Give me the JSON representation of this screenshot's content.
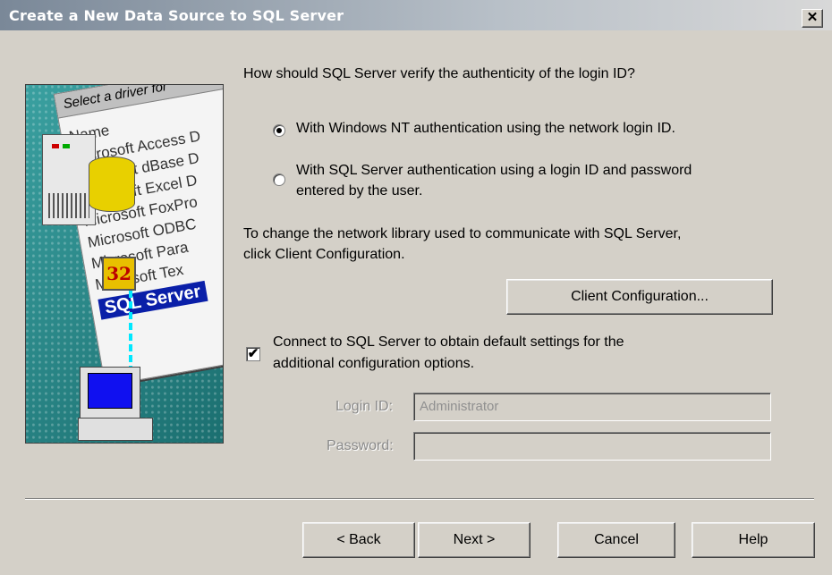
{
  "window": {
    "title": "Create a New Data Source to SQL Server",
    "close_glyph": "✕"
  },
  "illustration": {
    "header": "Select a driver for",
    "items": [
      "Name",
      "Microsoft Access D",
      "Microsoft dBase D",
      "Microsoft Excel D",
      "Microsoft FoxPro",
      "Microsoft ODBC",
      "Microsoft Para",
      "Microsoft Tex",
      "SQL Server"
    ],
    "badge": "32"
  },
  "auth": {
    "question": "How should SQL Server verify the authenticity of the login ID?",
    "option_nt": "With Windows NT authentication using the network login ID.",
    "option_sql_line1": "With SQL Server authentication using a login ID and password",
    "option_sql_line2": "entered by the user.",
    "selected": "nt"
  },
  "network": {
    "line1": "To change the network library used to communicate with SQL Server,",
    "line2": "click Client Configuration.",
    "button": "Client Configuration..."
  },
  "connect": {
    "checked": true,
    "check_glyph": "✔",
    "line1": "Connect to SQL Server to obtain default settings for the",
    "line2": "additional configuration options."
  },
  "login": {
    "login_label": "Login ID:",
    "login_value": "Administrator",
    "password_label": "Password:",
    "password_value": ""
  },
  "buttons": {
    "back": "< Back",
    "next": "Next >",
    "cancel": "Cancel",
    "help": "Help"
  }
}
